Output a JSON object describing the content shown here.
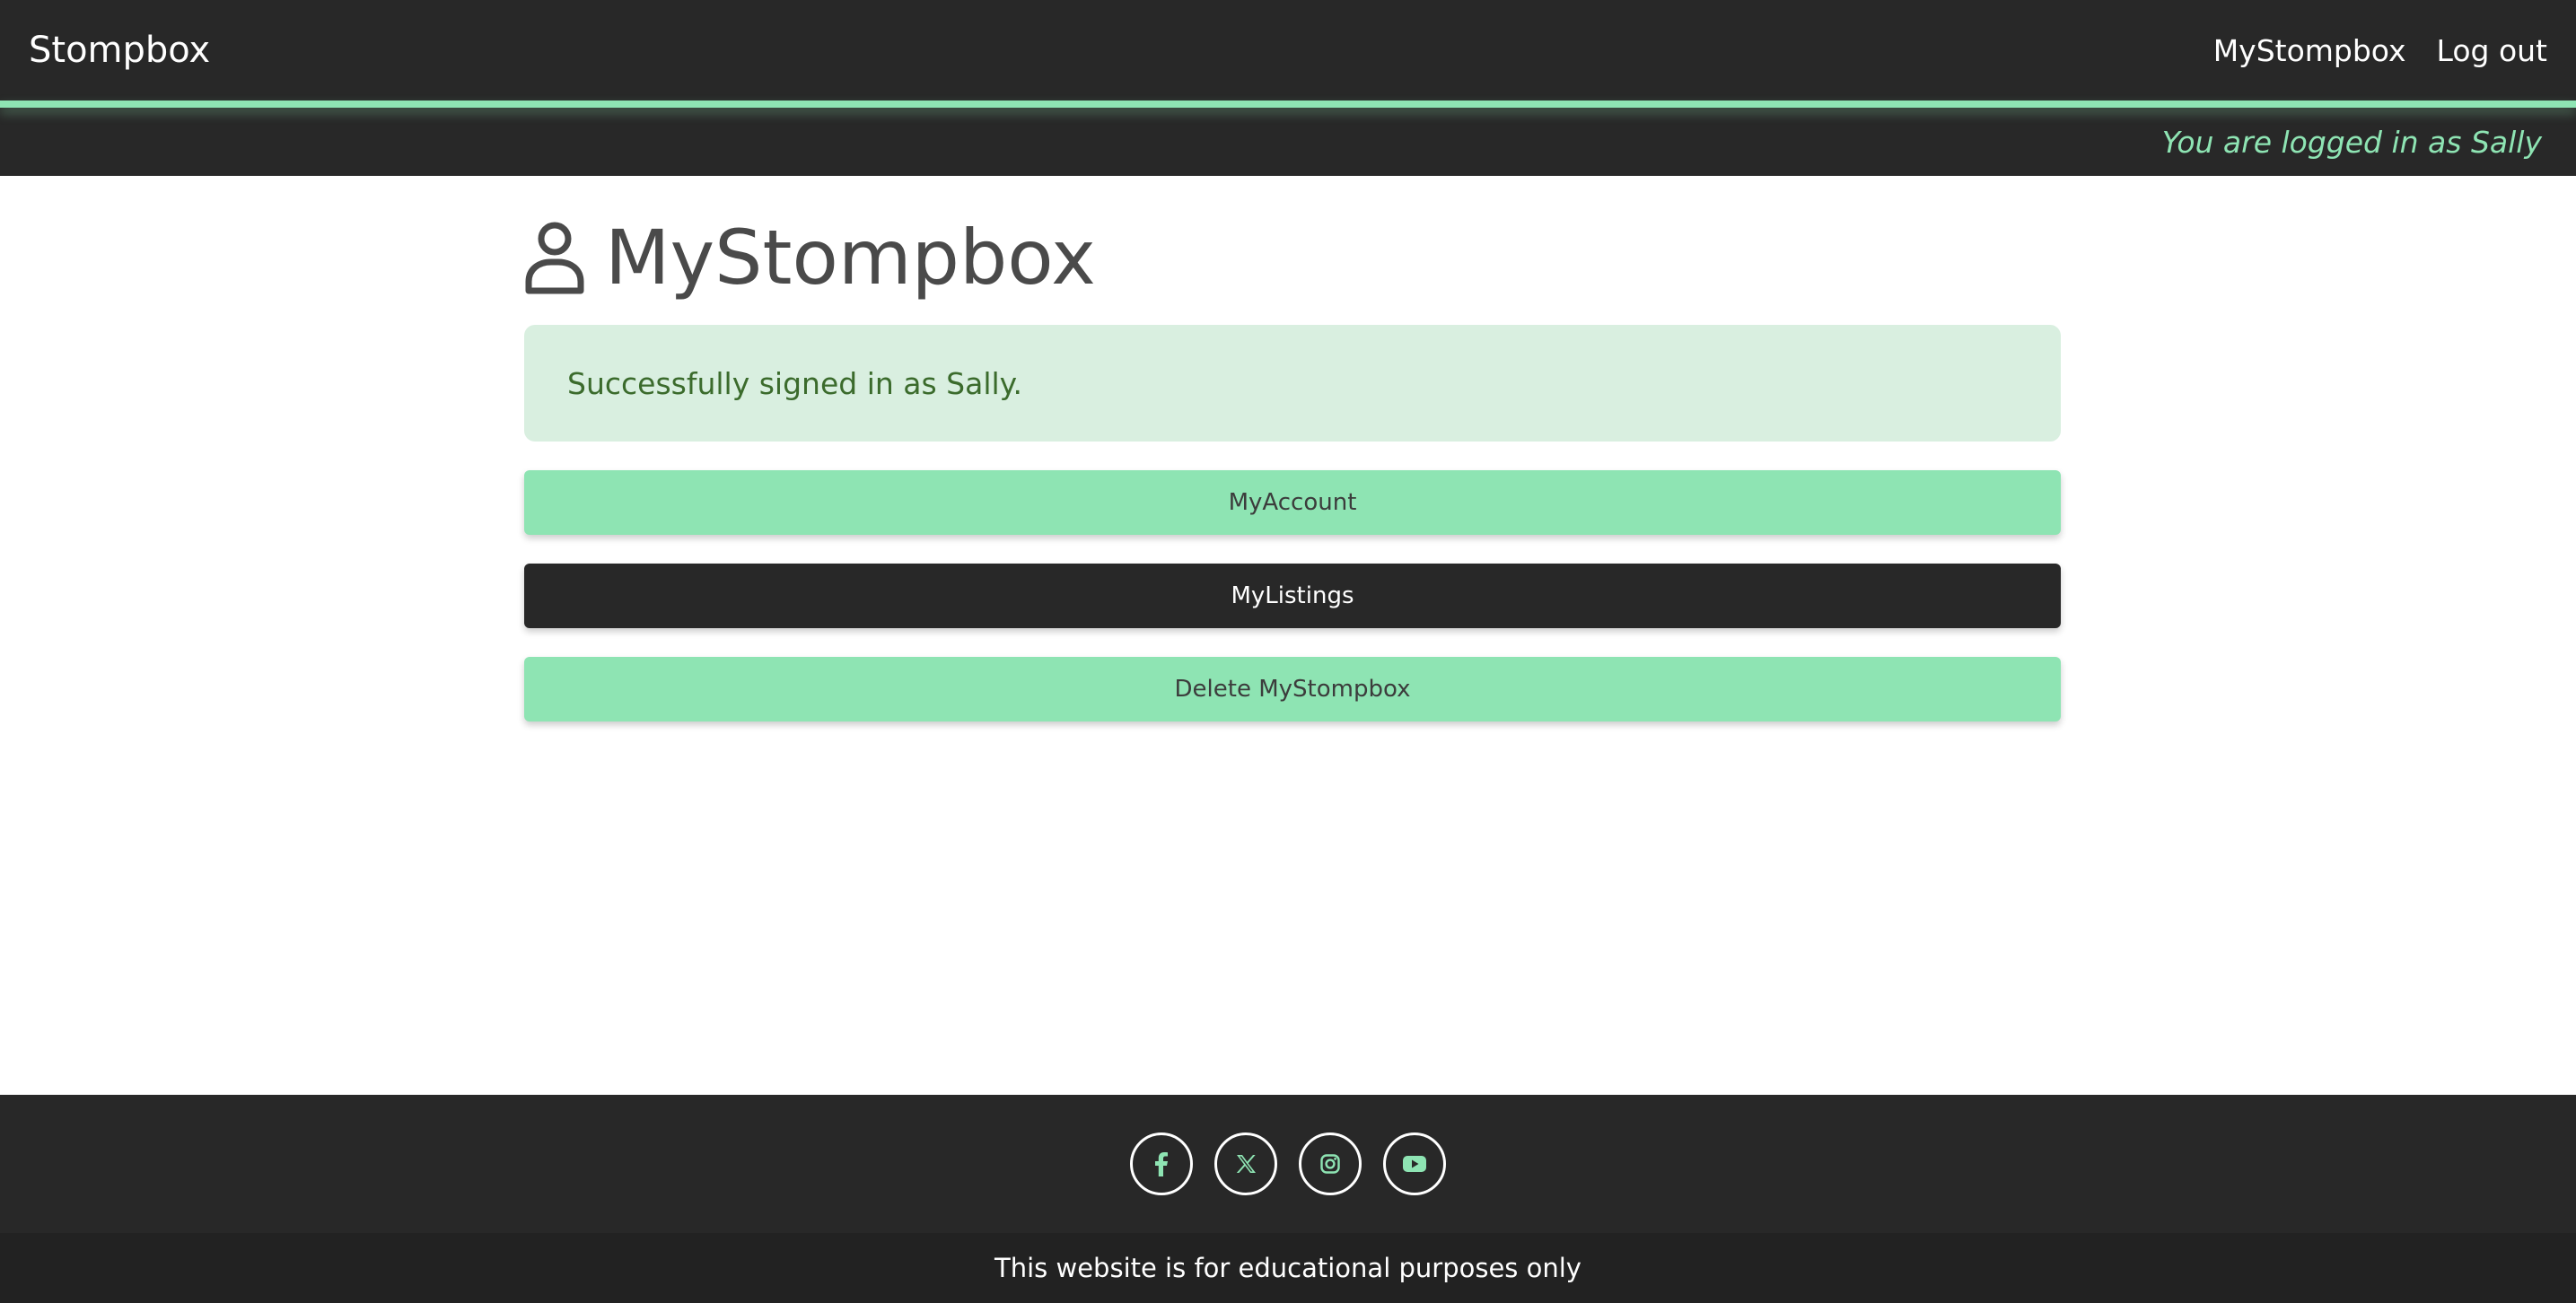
{
  "navbar": {
    "brand": "Stompbox",
    "links": [
      {
        "label": "MyStompbox"
      },
      {
        "label": "Log out"
      }
    ]
  },
  "status": {
    "text": "You are logged in as Sally"
  },
  "main": {
    "title": "MyStompbox",
    "title_icon": "user-icon",
    "alert": "Successfully signed in as Sally.",
    "buttons": [
      {
        "label": "MyAccount",
        "style": "green"
      },
      {
        "label": "MyListings",
        "style": "dark"
      },
      {
        "label": "Delete MyStompbox",
        "style": "green"
      }
    ]
  },
  "footer": {
    "social": [
      {
        "icon": "facebook-icon"
      },
      {
        "icon": "x-icon"
      },
      {
        "icon": "instagram-icon"
      },
      {
        "icon": "youtube-icon"
      }
    ],
    "note": "This website is for educational purposes only"
  },
  "colors": {
    "accent": "#8ee4b3",
    "dark": "#282828",
    "alert_bg": "#d9efe0",
    "alert_text": "#3b6b2c"
  }
}
